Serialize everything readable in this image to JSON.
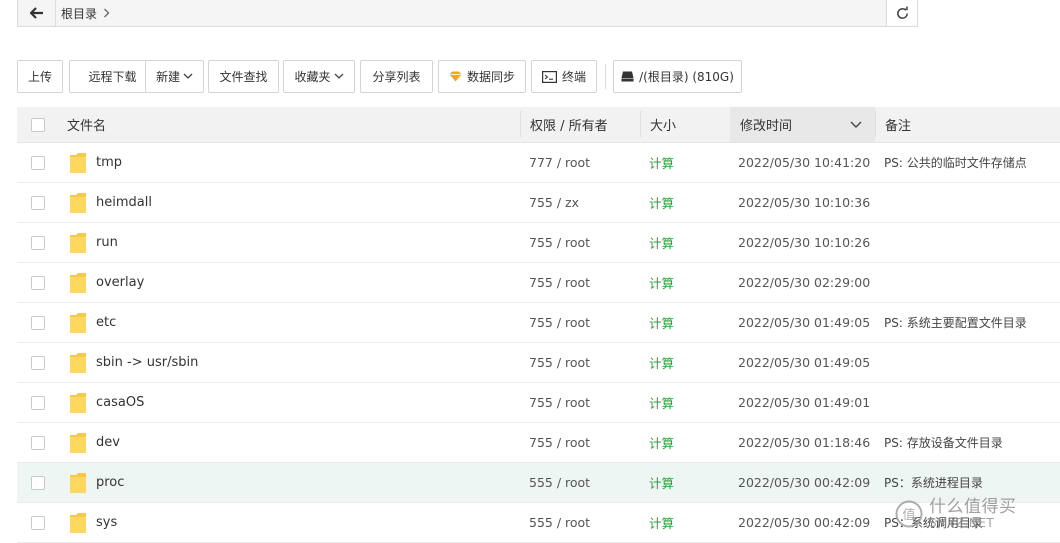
{
  "path_bar": {
    "back_icon": "arrow-left-icon",
    "crumb": "根目录",
    "crumb_separator_icon": "chevron-right-icon",
    "refresh_icon": "refresh-icon"
  },
  "toolbar": {
    "upload": "上传",
    "remote_download": "远程下载",
    "new": "新建",
    "file_search": "文件查找",
    "favorites": "收藏夹",
    "share_list": "分享列表",
    "data_sync": "数据同步",
    "terminal": "终端",
    "disk": "/(根目录) (810G)",
    "icons": {
      "new_caret": "chevron-down-icon",
      "favorites_caret": "chevron-down-icon",
      "data_sync": "diamond-icon",
      "terminal": "terminal-icon",
      "disk": "disk-icon"
    },
    "colors": {
      "data_sync_icon": "#f5a623"
    }
  },
  "table": {
    "columns": {
      "name": "文件名",
      "perm_owner": "权限 / 所有者",
      "size": "大小",
      "modified": "修改时间",
      "note": "备注"
    },
    "sorted_column": "modified",
    "sort_icon": "chevron-down-icon",
    "rows": [
      {
        "name": "tmp",
        "perm": "777 / root",
        "size": "计算",
        "modified": "2022/05/30 10:41:20",
        "note": "PS: 公共的临时文件存储点"
      },
      {
        "name": "heimdall",
        "perm": "755 / zx",
        "size": "计算",
        "modified": "2022/05/30 10:10:36",
        "note": ""
      },
      {
        "name": "run",
        "perm": "755 / root",
        "size": "计算",
        "modified": "2022/05/30 10:10:26",
        "note": ""
      },
      {
        "name": "overlay",
        "perm": "755 / root",
        "size": "计算",
        "modified": "2022/05/30 02:29:00",
        "note": ""
      },
      {
        "name": "etc",
        "perm": "755 / root",
        "size": "计算",
        "modified": "2022/05/30 01:49:05",
        "note": "PS: 系统主要配置文件目录"
      },
      {
        "name": "sbin -> usr/sbin",
        "perm": "755 / root",
        "size": "计算",
        "modified": "2022/05/30 01:49:05",
        "note": ""
      },
      {
        "name": "casaOS",
        "perm": "755 / root",
        "size": "计算",
        "modified": "2022/05/30 01:49:01",
        "note": ""
      },
      {
        "name": "dev",
        "perm": "755 / root",
        "size": "计算",
        "modified": "2022/05/30 01:18:46",
        "note": "PS: 存放设备文件目录"
      },
      {
        "name": "proc",
        "perm": "555 / root",
        "size": "计算",
        "modified": "2022/05/30 00:42:09",
        "note": "PS：系统进程目录"
      },
      {
        "name": "sys",
        "perm": "555 / root",
        "size": "计算",
        "modified": "2022/05/30 00:42:09",
        "note": "PS：系统调用目录"
      }
    ],
    "highlight_row": "proc",
    "folder_icon": "folder-icon",
    "colors": {
      "size_link": "#20a53a",
      "folder": "#f7c948",
      "highlight_row": "#eef6f3"
    }
  },
  "watermark": {
    "logo_icon": "smzdm-logo-icon",
    "text": "什么值得买",
    "site": "SMYZ.NET"
  }
}
